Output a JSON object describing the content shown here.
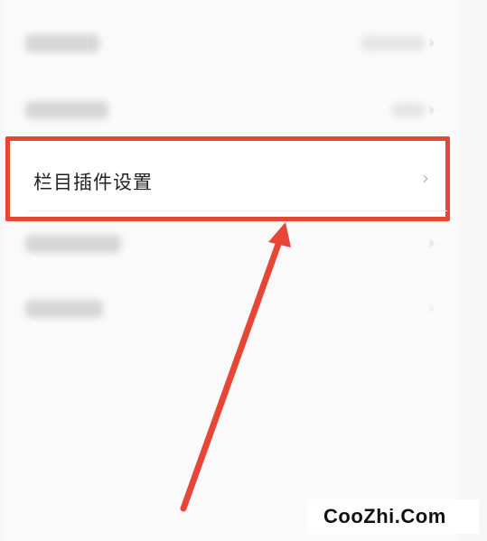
{
  "settings": {
    "highlighted_item": {
      "label": "栏目插件设置",
      "chevron": "›"
    },
    "blurred_chevron": "›"
  },
  "annotation": {
    "highlight_color": "#e74637",
    "arrow_color": "#e74637"
  },
  "watermark": {
    "text": "CooZhi.Com"
  },
  "icons": {
    "chevron": "chevron-right-icon"
  }
}
